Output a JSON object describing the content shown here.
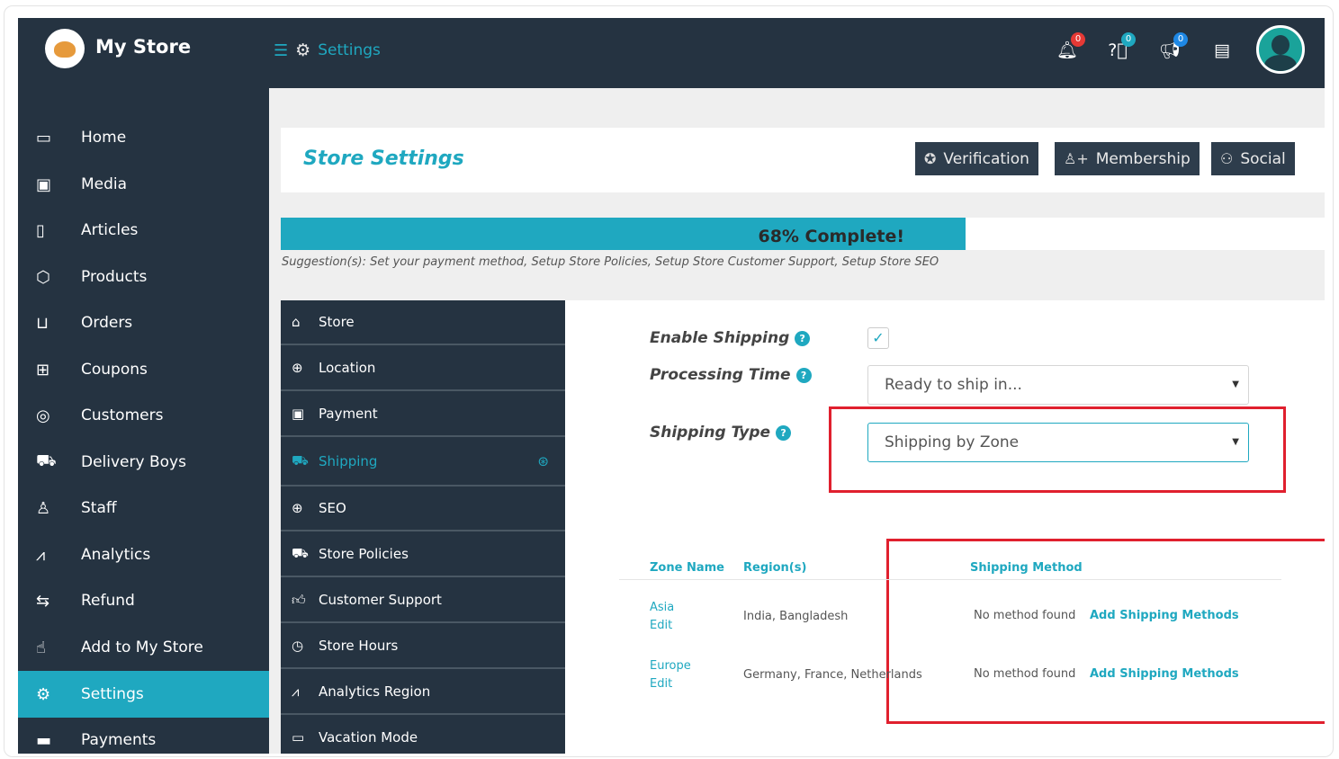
{
  "app": {
    "title": "My Store"
  },
  "breadcrumb": {
    "label": "Settings"
  },
  "topbar": {
    "notifications": {
      "icon": "bell-icon",
      "count": "0",
      "color": "#e53935"
    },
    "help": {
      "icon": "question-icon",
      "count": "0",
      "color": "#1fa8c0"
    },
    "announcements": {
      "icon": "megaphone-icon",
      "count": "0",
      "color": "#1e88e5"
    },
    "knowledgebase": {
      "icon": "book-icon"
    }
  },
  "sidebar": {
    "items": [
      {
        "label": "Home",
        "icon": "monitor-icon"
      },
      {
        "label": "Media",
        "icon": "image-icon"
      },
      {
        "label": "Articles",
        "icon": "file-icon"
      },
      {
        "label": "Products",
        "icon": "cube-icon"
      },
      {
        "label": "Orders",
        "icon": "cart-icon"
      },
      {
        "label": "Coupons",
        "icon": "gift-icon"
      },
      {
        "label": "Customers",
        "icon": "user-circle-icon"
      },
      {
        "label": "Delivery Boys",
        "icon": "truck-icon"
      },
      {
        "label": "Staff",
        "icon": "user-icon"
      },
      {
        "label": "Analytics",
        "icon": "chart-icon"
      },
      {
        "label": "Refund",
        "icon": "retweet-icon"
      },
      {
        "label": "Add to My Store",
        "icon": "hand-pointer-icon"
      },
      {
        "label": "Settings",
        "icon": "gears-icon",
        "active": true
      },
      {
        "label": "Payments",
        "icon": "credit-card-icon"
      }
    ]
  },
  "header": {
    "title": "Store Settings",
    "buttons": [
      {
        "label": "Verification",
        "icon": "award-icon"
      },
      {
        "label": "Membership",
        "icon": "user-plus-icon"
      },
      {
        "label": "Social",
        "icon": "users-icon"
      }
    ]
  },
  "progress": {
    "percent": 68,
    "label": "68% Complete!",
    "suggestion": "Suggestion(s): Set your payment method, Setup Store Policies, Setup Store Customer Support, Setup Store SEO"
  },
  "tabs": [
    {
      "label": "Store",
      "icon": "shopping-bag-icon"
    },
    {
      "label": "Location",
      "icon": "globe-icon"
    },
    {
      "label": "Payment",
      "icon": "money-icon"
    },
    {
      "label": "Shipping",
      "icon": "truck-icon",
      "active": true
    },
    {
      "label": "SEO",
      "icon": "globe-icon"
    },
    {
      "label": "Store Policies",
      "icon": "truck-icon"
    },
    {
      "label": "Customer Support",
      "icon": "thumbs-up-icon"
    },
    {
      "label": "Store Hours",
      "icon": "clock-icon"
    },
    {
      "label": "Analytics Region",
      "icon": "chart-icon"
    },
    {
      "label": "Vacation Mode",
      "icon": "tape-icon"
    }
  ],
  "shipping": {
    "enable_label": "Enable Shipping",
    "enabled": true,
    "processing_label": "Processing Time",
    "processing_value": "Ready to ship in...",
    "type_label": "Shipping Type",
    "type_value": "Shipping by Zone"
  },
  "zones": {
    "headers": {
      "zone": "Zone Name",
      "regions": "Region(s)",
      "method": "Shipping Method"
    },
    "rows": [
      {
        "name": "Asia",
        "edit": "Edit",
        "regions": "India, Bangladesh",
        "method": "No method found",
        "add": "Add Shipping Methods"
      },
      {
        "name": "Europe",
        "edit": "Edit",
        "regions": "Germany, France, Netherlands",
        "method": "No method found",
        "add": "Add Shipping Methods"
      }
    ]
  },
  "colors": {
    "accent": "#1fa8c0",
    "dark": "#253341",
    "highlight": "#e0202e"
  }
}
